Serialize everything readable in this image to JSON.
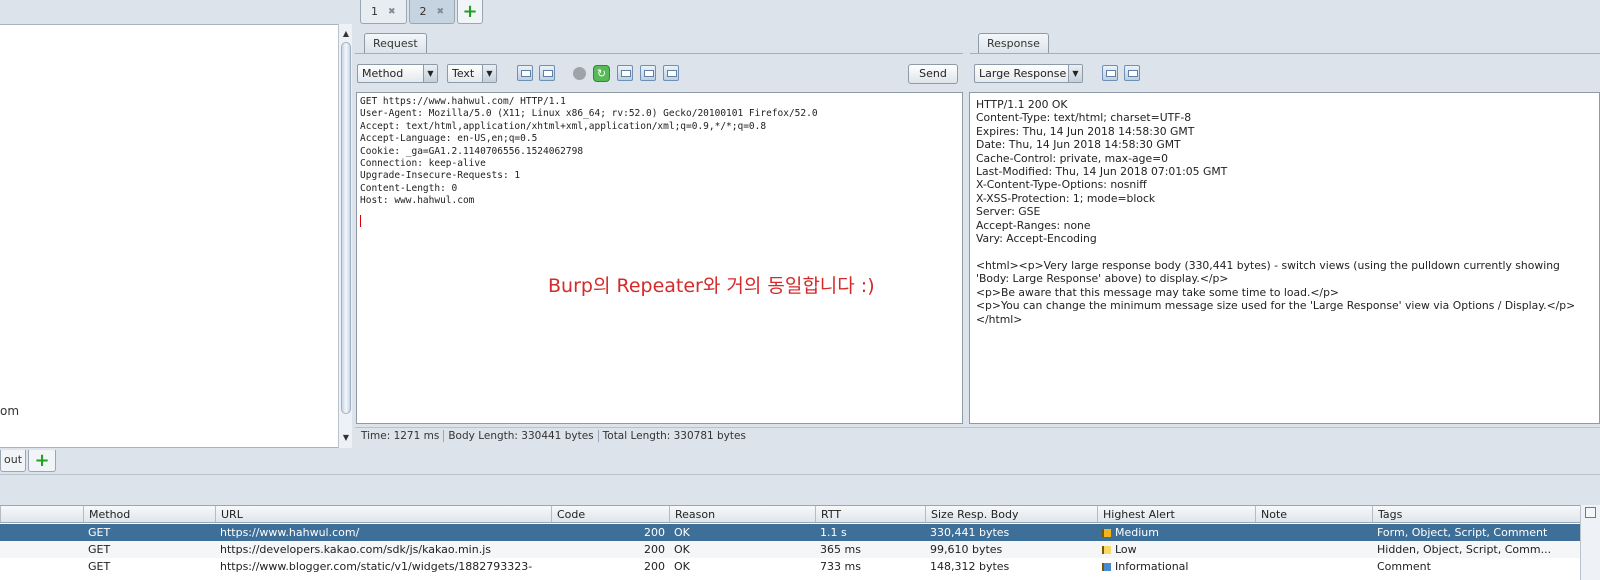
{
  "top_tabs": [
    {
      "label": "1",
      "active": false
    },
    {
      "label": "2",
      "active": true
    }
  ],
  "left_panel": {
    "fragment": "om"
  },
  "request": {
    "panel_label": "Request",
    "method_dropdown": "Method",
    "view_dropdown": "Text",
    "send_label": "Send",
    "lines": [
      "GET https://www.hahwul.com/ HTTP/1.1",
      "User-Agent: Mozilla/5.0 (X11; Linux x86_64; rv:52.0) Gecko/20100101 Firefox/52.0",
      "Accept: text/html,application/xhtml+xml,application/xml;q=0.9,*/*;q=0.8",
      "Accept-Language: en-US,en;q=0.5",
      "Cookie: _ga=GA1.2.1140706556.1524062798",
      "Connection: keep-alive",
      "Upgrade-Insecure-Requests: 1",
      "Content-Length: 0",
      "Host: www.hahwul.com"
    ]
  },
  "annotation": "Burp의 Repeater와 거의 동일합니다 :)",
  "response": {
    "panel_label": "Response",
    "view_dropdown": "Large Response",
    "body": "HTTP/1.1 200 OK\nContent-Type: text/html; charset=UTF-8\nExpires: Thu, 14 Jun 2018 14:58:30 GMT\nDate: Thu, 14 Jun 2018 14:58:30 GMT\nCache-Control: private, max-age=0\nLast-Modified: Thu, 14 Jun 2018 07:01:05 GMT\nX-Content-Type-Options: nosniff\nX-XSS-Protection: 1; mode=block\nServer: GSE\nAccept-Ranges: none\nVary: Accept-Encoding\n\n<html><p>Very large response body (330,441 bytes) - switch views (using the pulldown currently showing 'Body: Large Response' above) to display.</p>\n<p>Be aware that this message may take some time to load.</p>\n<p>You can change the minimum message size used for the 'Large Response' view via Options / Display.</p></html>"
  },
  "status": {
    "time": "Time: 1271 ms",
    "body_length": "Body Length: 330441 bytes",
    "total_length": "Total Length: 330781 bytes"
  },
  "bottom_tabs": [
    {
      "label": "out"
    }
  ],
  "history": {
    "columns": [
      "Method",
      "URL",
      "Code",
      "Reason",
      "RTT",
      "Size Resp. Body",
      "Highest Alert",
      "Note",
      "Tags"
    ],
    "rows": [
      {
        "method": "GET",
        "url": "https://www.hahwul.com/",
        "code": "200",
        "reason": "OK",
        "rtt": "1.1 s",
        "size": "330,441 bytes",
        "alert": "Medium",
        "note": "",
        "tags": "Form, Object, Script, Comment"
      },
      {
        "method": "GET",
        "url": "https://developers.kakao.com/sdk/js/kakao.min.js",
        "code": "200",
        "reason": "OK",
        "rtt": "365 ms",
        "size": "99,610 bytes",
        "alert": "Low",
        "note": "",
        "tags": "Hidden, Object, Script, Comm..."
      },
      {
        "method": "GET",
        "url": "https://www.blogger.com/static/v1/widgets/1882793323-",
        "code": "200",
        "reason": "OK",
        "rtt": "733 ms",
        "size": "148,312 bytes",
        "alert": "Informational",
        "note": "",
        "tags": "Comment"
      }
    ]
  }
}
